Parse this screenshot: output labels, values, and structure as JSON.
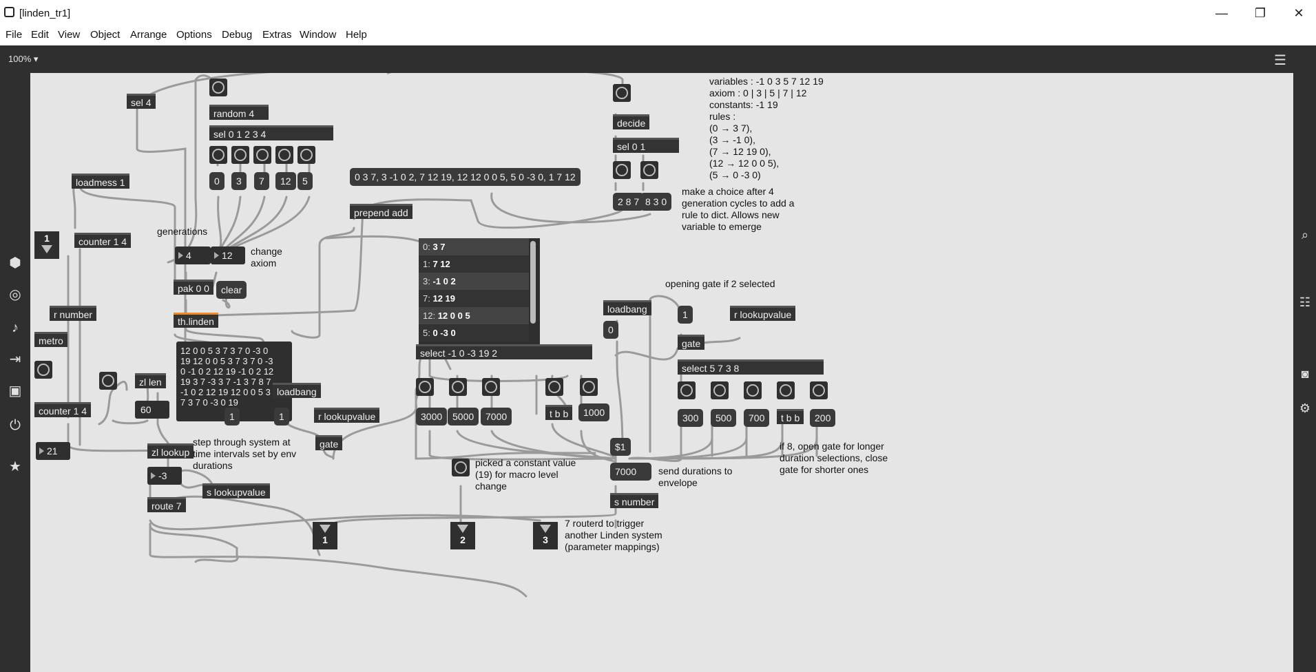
{
  "window": {
    "title": "[linden_tr1]",
    "minimize": "—",
    "restore": "❐",
    "close": "✕"
  },
  "menu": [
    "File",
    "Edit",
    "View",
    "Object",
    "Arrange",
    "Options",
    "Debug",
    "Extras",
    "Window",
    "Help"
  ],
  "toolbar": {
    "zoom": "100%"
  },
  "objects": {
    "sel4": "sel 4",
    "random4": "random 4",
    "sel01234": "sel 0 1 2 3 4",
    "loadmess": "loadmess 1",
    "counter14a": "counter 1 4",
    "pak": "pak 0 0",
    "thlinden": "th.linden",
    "rnumber": "r number",
    "metro": "metro",
    "counter14b": "counter 1 4",
    "zllen": "zl len",
    "zllookup": "zl lookup",
    "route7": "route 7",
    "slookupvalue": "s lookupvalue",
    "loadbang1": "loadbang",
    "rlookupvalue1": "r lookupvalue",
    "gate1": "gate",
    "prepend": "prepend add",
    "select1": "select -1 0 -3 19 2",
    "tbb1": "t b b",
    "decide": "decide",
    "sel01": "sel 0 1",
    "loadbang2": "loadbang",
    "rlookupvalue2": "r lookupvalue",
    "gate2": "gate",
    "select2": "select 5 7 3 8",
    "tbb2": "t b b",
    "dollar1": "$1",
    "snumber": "s number"
  },
  "messages": {
    "m0": "0",
    "m3": "3",
    "m7": "7",
    "m12": "12",
    "m5": "5",
    "clear": "clear",
    "big": "0 3 7, 3 -1 0 2, 7 12 19, 12 12 0 0 5, 5 0 -3 0, 1 7 12",
    "m287": "2 8 7",
    "m830": "8 3 0",
    "m1a": "1",
    "m0b": "0",
    "m1b": "1",
    "m3000": "3000",
    "m5000": "5000",
    "m7000": "7000",
    "m1000": "1000",
    "m300": "300",
    "m500": "500",
    "m700": "700",
    "m200": "200",
    "m0c": "0",
    "m7000b": "7000"
  },
  "numbers": {
    "gen": "4",
    "axiom": "12",
    "n60": "60",
    "n21": "21",
    "nm3": "-3"
  },
  "textbox": "12 0 0 5 3 7 3 7 0 -3 0\n19 12 0 0 5 3 7 3 7 0 -3\n0 -1 0 2 12 19 -1 0 2 12\n19 3 7 -3 3 7 -1 3 7 8 7\n-1 0 2 12 19 12 0 0 5 3\n7 3 7 0 -3 0 19",
  "dict": [
    {
      "k": "0:",
      "v": "3 7"
    },
    {
      "k": "1:",
      "v": "7 12"
    },
    {
      "k": "3:",
      "v": "-1 0 2"
    },
    {
      "k": "7:",
      "v": "12 19"
    },
    {
      "k": "12:",
      "v": "12 0 0 5"
    },
    {
      "k": "5:",
      "v": "0 -3 0"
    }
  ],
  "inlets": {
    "i1a": "1",
    "o1": "1",
    "o2": "2",
    "o3": "3"
  },
  "comments": {
    "generations": "generations",
    "change_axiom": "change\naxiom",
    "rules": "variables : -1 0 3 5 7 12 19\naxiom : 0 | 3 | 5 | 7 | 12\nconstants: -1 19\nrules :\n(0 → 3 7),\n(3 → -1 0),\n(7 → 12 19 0),\n(12 → 12 0 0 5),\n(5 → 0 -3 0)",
    "choice": "make a choice after 4\ngeneration cycles to add a\nrule to dict. Allows new\nvariable to emerge",
    "opening": "opening gate if 2 selected",
    "step": "step through system at\ntime intervals set by env\ndurations",
    "picked": "picked a constant value\n(19) for macro level\nchange",
    "send": "send durations to\nenvelope",
    "if8": "if 8, open gate for longer\nduration selections, close\ngate for shorter ones",
    "routerd": "7 routerd to trigger\nanother Linden system\n(parameter mappings)"
  }
}
